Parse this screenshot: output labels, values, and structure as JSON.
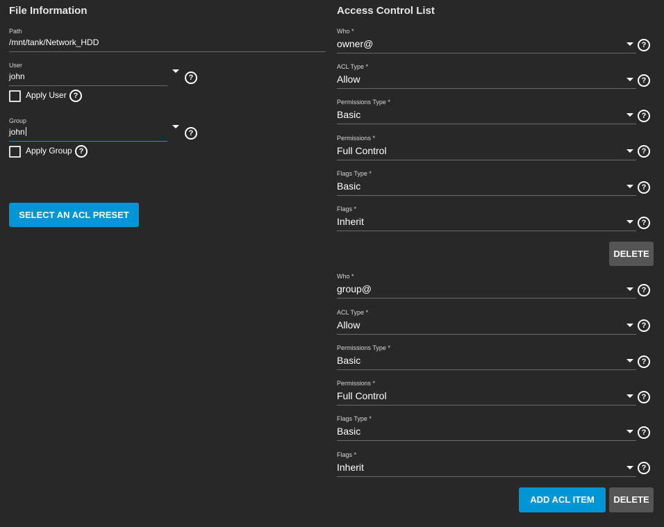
{
  "file_info": {
    "title": "File Information",
    "path": {
      "label": "Path",
      "value": "/mnt/tank/Network_HDD"
    },
    "user": {
      "label": "User",
      "value": "john",
      "apply_label": "Apply User"
    },
    "group": {
      "label": "Group",
      "value": "john",
      "apply_label": "Apply Group"
    },
    "preset_button": "SELECT AN ACL PRESET",
    "help_glyph": "?"
  },
  "acl": {
    "title": "Access Control List",
    "items": [
      {
        "who_label": "Who *",
        "who": "owner@",
        "acl_type_label": "ACL Type *",
        "acl_type": "Allow",
        "perm_type_label": "Permissions Type *",
        "perm_type": "Basic",
        "perms_label": "Permissions *",
        "perms": "Full Control",
        "flags_type_label": "Flags Type *",
        "flags_type": "Basic",
        "flags_label": "Flags *",
        "flags": "Inherit",
        "delete_label": "DELETE"
      },
      {
        "who_label": "Who *",
        "who": "group@",
        "acl_type_label": "ACL Type *",
        "acl_type": "Allow",
        "perm_type_label": "Permissions Type *",
        "perm_type": "Basic",
        "perms_label": "Permissions *",
        "perms": "Full Control",
        "flags_type_label": "Flags Type *",
        "flags_type": "Basic",
        "flags_label": "Flags *",
        "flags": "Inherit",
        "delete_label": "DELETE"
      }
    ],
    "add_button": "ADD ACL ITEM"
  },
  "colors": {
    "background": "#282828",
    "primary": "#0095d5",
    "secondary": "#555555"
  }
}
